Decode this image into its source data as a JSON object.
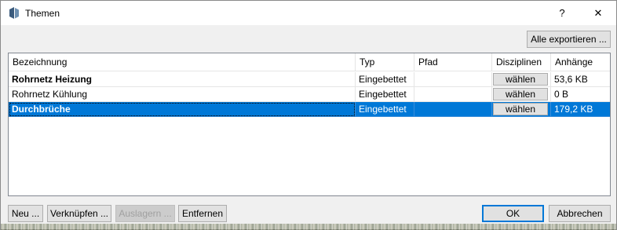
{
  "window": {
    "title": "Themen",
    "help_label": "?",
    "close_label": "✕",
    "icon": "app-logo-icon"
  },
  "toolbar": {
    "export_all_label": "Alle exportieren ..."
  },
  "table": {
    "columns": [
      "Bezeichnung",
      "Typ",
      "Pfad",
      "Disziplinen",
      "Anhänge"
    ],
    "rows": [
      {
        "name": "Rohrnetz Heizung",
        "type": "Eingebettet",
        "path": "",
        "disciplines": "wählen",
        "attachments": "53,6 KB",
        "bold": true,
        "selected": false
      },
      {
        "name": "Rohrnetz Kühlung",
        "type": "Eingebettet",
        "path": "",
        "disciplines": "wählen",
        "attachments": "0 B",
        "bold": false,
        "selected": false
      },
      {
        "name": "Durchbrüche",
        "type": "Eingebettet",
        "path": "",
        "disciplines": "wählen",
        "attachments": "179,2 KB",
        "bold": true,
        "selected": true
      }
    ]
  },
  "footer": {
    "new_label": "Neu ...",
    "link_label": "Verknüpfen ...",
    "archive_label": "Auslagern ...",
    "remove_label": "Entfernen",
    "ok_label": "OK",
    "cancel_label": "Abbrechen"
  },
  "colors": {
    "selection": "#0078d7",
    "window_bg": "#f0f0f0"
  }
}
